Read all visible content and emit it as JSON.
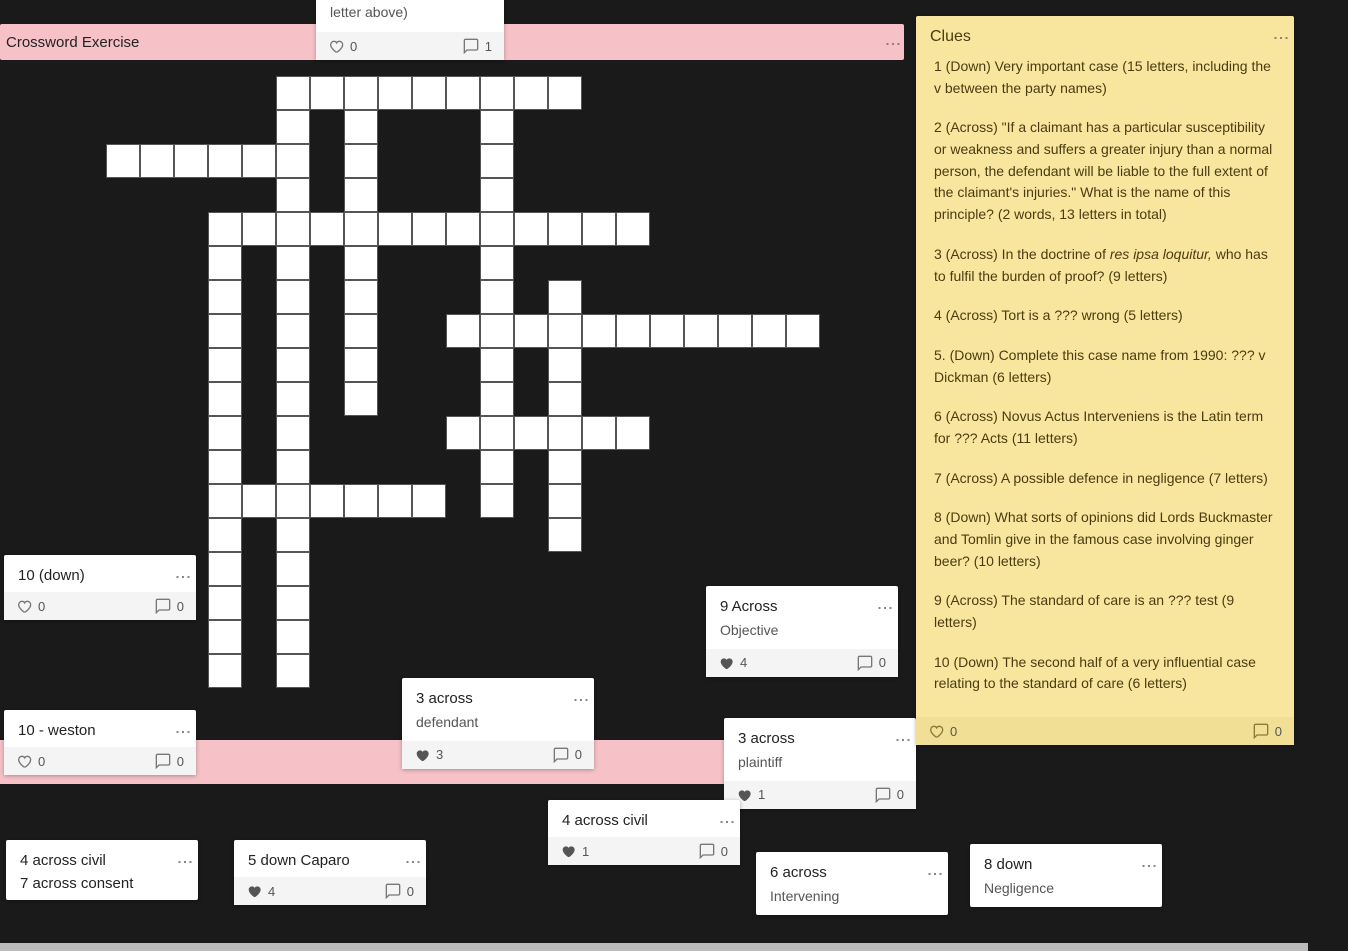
{
  "header": {
    "title": "Crossword Exercise"
  },
  "partial_top": {
    "text": "letter above)",
    "likes": "0",
    "comments": "1"
  },
  "cards": {
    "ten_down": {
      "title": "10 (down)",
      "likes": "0",
      "comments": "0"
    },
    "ten_weston": {
      "title": "10 - weston",
      "likes": "0",
      "comments": "0"
    },
    "nine_across": {
      "title": "9 Across",
      "body": "Objective",
      "likes": "4",
      "comments": "0"
    },
    "three_across_a": {
      "title": "3 across",
      "body": "defendant",
      "likes": "3",
      "comments": "0"
    },
    "three_across_b": {
      "title": "3 across",
      "body": "plaintiff",
      "likes": "1",
      "comments": "0"
    },
    "four_civil": {
      "title": "4 across civil",
      "likes": "1",
      "comments": "0"
    },
    "four_seven": {
      "line1": "4 across civil",
      "line2": "7 across consent"
    },
    "five_caparo": {
      "title": "5 down Caparo",
      "likes": "4",
      "comments": "0"
    },
    "six_across": {
      "title": "6 across",
      "body": "Intervening"
    },
    "eight_down": {
      "title": "8 down",
      "body": "Negligence"
    }
  },
  "clues": {
    "title": "Clues",
    "items": [
      "1 (Down) Very important case (15 letters, including the v between the party names)",
      "2 (Across) \"If a claimant has a particular susceptibility or weakness and suffers a greater injury than a normal person, the defendant will be liable to the full extent of the claimant's injuries.\" What is the name of this principle? (2 words, 13 letters in total)",
      "3 (Across) In the doctrine of <em>res ipsa loquitur,</em> who has to fulfil the burden of proof? (9 letters)",
      "4 (Across) Tort is a ??? wrong (5 letters)",
      "5. (Down) Complete this case name from 1990: ??? v Dickman (6 letters)",
      "6 (Across) Novus Actus Interveniens is the Latin term for ??? Acts (11 letters)",
      "7 (Across) A possible defence in negligence (7 letters)",
      "8 (Down) What sorts of opinions did Lords Buckmaster and Tomlin give in the famous case involving ginger beer? (10 letters)",
      "9 (Across) The standard of care is an ??? test (9 letters)",
      "10 (Down) The second half of a very influential case relating to the standard of care (6 letters)"
    ],
    "likes": "0",
    "comments": "0"
  }
}
